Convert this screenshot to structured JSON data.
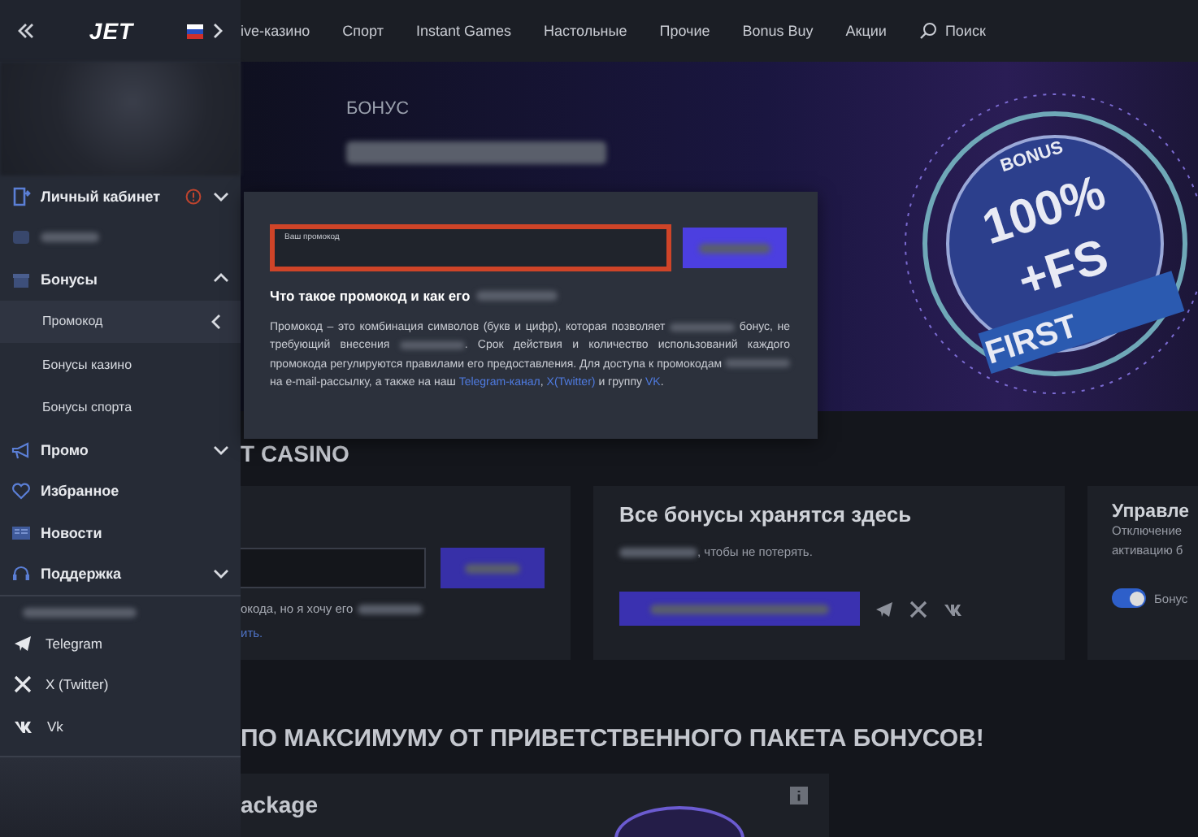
{
  "sidebar": {
    "logo": "JET",
    "menu": [
      {
        "kind": "item",
        "label": "Личный кабинет",
        "alert": true,
        "expanded": false
      },
      {
        "kind": "blurred"
      },
      {
        "kind": "item",
        "label": "Бонусы",
        "expanded": true,
        "children": [
          {
            "label": "Промокод",
            "selected": true
          },
          {
            "label": "Бонусы казино",
            "selected": false
          },
          {
            "label": "Бонусы спорта",
            "selected": false
          }
        ]
      },
      {
        "kind": "item",
        "label": "Промо",
        "expanded": false
      },
      {
        "kind": "item",
        "label": "Избранное"
      },
      {
        "kind": "item",
        "label": "Новости"
      },
      {
        "kind": "item",
        "label": "Поддержка",
        "expanded": false
      }
    ],
    "socials": [
      {
        "label": "Telegram"
      },
      {
        "label": "X (Twitter)"
      },
      {
        "label": "Vk"
      }
    ]
  },
  "nav": {
    "items": [
      "ive-казино",
      "Спорт",
      "Instant Games",
      "Настольные",
      "Прочие",
      "Bonus Buy",
      "Акции"
    ],
    "search": "Поиск"
  },
  "hero": {
    "label": "БОНУС",
    "badge": {
      "top": "BONUS",
      "main": "100%",
      "sub": "+FS",
      "ribbon": "FIRST"
    }
  },
  "promo_popup": {
    "field": {
      "placeholder": "Ваш промокод"
    },
    "heading": [
      {
        "kind": "text",
        "text": "Что такое промокод и как его"
      },
      {
        "kind": "blur"
      }
    ],
    "paragraph": [
      {
        "kind": "text",
        "text": "Промокод – это комбинация символов (букв и цифр), которая позволяет"
      },
      {
        "kind": "blur"
      },
      {
        "kind": "text",
        "text": "бонус, не требующий внесения"
      },
      {
        "kind": "blur"
      },
      {
        "kind": "text",
        "text": ". Срок действия и количество использований каждого промокода регулируются правилами его предоставления. Для доступа к промокодам"
      },
      {
        "kind": "blur"
      },
      {
        "kind": "text",
        "text": "на e-mail-рассылку, а также на наш"
      },
      {
        "kind": "link",
        "text": "Telegram-канал"
      },
      {
        "kind": "text",
        "text": ","
      },
      {
        "kind": "link",
        "text": "X(Twitter)"
      },
      {
        "kind": "text",
        "text": "и группу"
      },
      {
        "kind": "link",
        "text": "VK"
      },
      {
        "kind": "text",
        "text": "."
      }
    ]
  },
  "section_title": "T CASINO",
  "promo_card": {
    "note": "окода, но я хочу его",
    "link": "ить."
  },
  "bonus_card": {
    "title": "Все бонусы хранятся здесь",
    "subtitle": ", чтобы не потерять."
  },
  "manage_card": {
    "title": "Управле",
    "lines": [
      "Отключение",
      "активацию б"
    ],
    "toggle": {
      "label": "Бонус",
      "on": true
    }
  },
  "welcome_title": "ПО МАКСИМУМУ ОТ ПРИВЕТСТВЕННОГО ПАКЕТА БОНУСОВ!",
  "package_card": {
    "title": "ackage"
  }
}
